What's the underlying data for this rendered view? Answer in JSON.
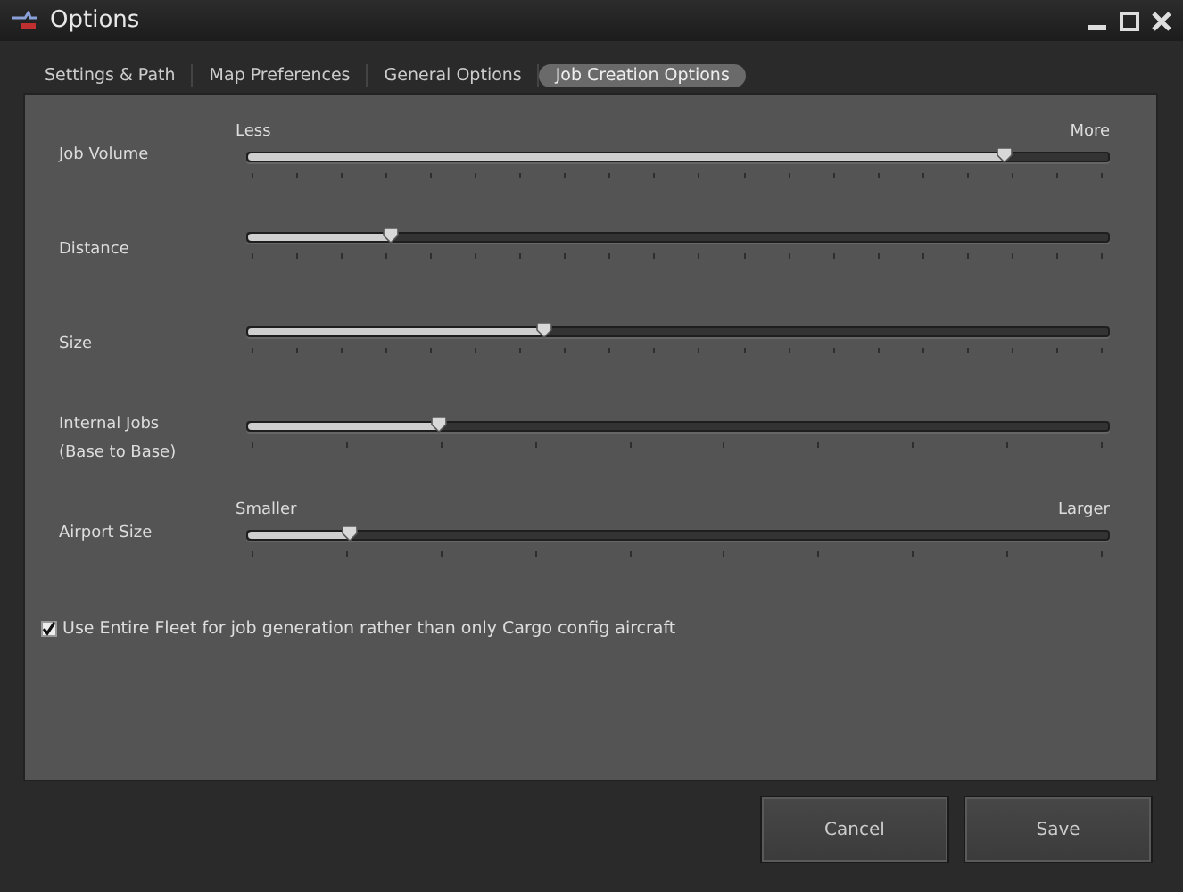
{
  "window": {
    "title": "Options"
  },
  "tabs": [
    {
      "label": "Settings & Path",
      "selected": false
    },
    {
      "label": "Map Preferences",
      "selected": false
    },
    {
      "label": "General Options",
      "selected": false
    },
    {
      "label": "Job Creation Options",
      "selected": true
    }
  ],
  "sliders": [
    {
      "label": "Job Volume",
      "min_label": "Less",
      "max_label": "More",
      "level": 0.88
    },
    {
      "label": "Distance",
      "level": 0.165
    },
    {
      "label": "Size",
      "level": 0.345
    },
    {
      "label": "Internal Jobs",
      "sublabel": "(Base to Base)",
      "level": 0.223
    },
    {
      "label": "Airport Size",
      "min_label": "Smaller",
      "max_label": "Larger",
      "level": 0.118
    }
  ],
  "fleet_option": {
    "label": "Use Entire Fleet for job generation rather than only Cargo config aircraft",
    "checked": true
  },
  "buttons": [
    "Cancel",
    "Save"
  ]
}
